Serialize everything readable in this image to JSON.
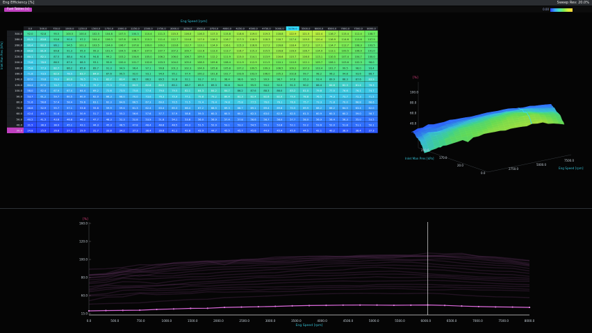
{
  "window": {
    "title": "Eng Efficiency [%]",
    "status_right": "Sweep Rev: 20.0%",
    "legend_text": "0.00"
  },
  "toolbar": {
    "chip_label": "Fuel Tables",
    "chip_suffix": "[s]"
  },
  "table": {
    "x_axis_title": "Eng Speed [rpm]",
    "y_axis_title": "Inlet Man Pres [kPa]",
    "columns": [
      "0.0",
      "500.0",
      "750.0",
      "1000.0",
      "1250.0",
      "1500.0",
      "1750.0",
      "2000.0",
      "2250.0",
      "2500.0",
      "2750.0",
      "3000.0",
      "3250.0",
      "3500.0",
      "3750.0",
      "4000.0",
      "4250.0",
      "4500.0",
      "4750.0",
      "5000.0",
      "5250.0",
      "5500.0",
      "6000.0",
      "6500.0",
      "7000.0",
      "7500.0",
      "8000.0"
    ],
    "rows": [
      "300.0",
      "280.0",
      "260.0",
      "240.0",
      "220.0",
      "200.0",
      "180.0",
      "160.0",
      "140.0",
      "120.0",
      "100.0",
      "90.0",
      "80.0",
      "70.0",
      "60.0",
      "50.0",
      "40.0",
      "30.0"
    ],
    "values": [
      [
        92.0,
        92.8,
        95.5,
        100.5,
        100.0,
        102.5,
        104.8,
        107.5,
        100.3,
        110.4,
        111.3,
        115.3,
        116.0,
        116.3,
        117.3,
        115.8,
        118.6,
        119.0,
        119.3,
        118.8,
        122.9,
        121.5,
        122.4,
        116.7,
        115.4,
        112.4,
        108.7
      ],
      [
        81.5,
        83.8,
        93.6,
        90.0,
        97.2,
        104.4,
        106.3,
        107.8,
        108.3,
        110.2,
        111.4,
        112.7,
        114.8,
        117.0,
        116.3,
        116.7,
        117.3,
        118.5,
        118.3,
        118.7,
        117.4,
        119.5,
        120.4,
        116.9,
        114.6,
        110.6,
        107.9
      ],
      [
        80.4,
        82.3,
        86.1,
        94.5,
        101.3,
        103.5,
        104.0,
        106.7,
        107.8,
        109.0,
        109.2,
        110.6,
        112.7,
        113.1,
        114.9,
        116.1,
        115.3,
        116.6,
        117.2,
        116.8,
        118.4,
        117.2,
        117.1,
        114.7,
        112.7,
        108.3,
        103.5
      ],
      [
        80.8,
        81.9,
        89.8,
        91.3,
        95.0,
        99.3,
        101.4,
        104.5,
        106.7,
        107.9,
        107.7,
        107.2,
        109.7,
        112.6,
        113.0,
        113.7,
        116.7,
        115.3,
        115.5,
        116.8,
        116.9,
        116.7,
        114.9,
        113.1,
        109.5,
        106.9,
        101.0
      ],
      [
        80.1,
        82.1,
        87.5,
        88.4,
        90.8,
        94.8,
        99.2,
        103.2,
        104.6,
        105.0,
        106.2,
        106.0,
        106.7,
        109.3,
        112.2,
        111.9,
        115.0,
        114.1,
        113.9,
        116.6,
        115.7,
        116.0,
        113.1,
        110.5,
        107.4,
        104.7,
        100.0
      ],
      [
        75.6,
        78.9,
        86.5,
        87.0,
        88.5,
        93.1,
        95.6,
        100.4,
        101.7,
        102.8,
        103.3,
        104.0,
        105.0,
        108.5,
        109.6,
        108.4,
        111.9,
        112.9,
        111.5,
        110.1,
        110.9,
        112.1,
        109.7,
        106.1,
        103.6,
        102.3,
        98.0
      ],
      [
        75.8,
        77.3,
        82.7,
        86.2,
        85.8,
        89.7,
        91.3,
        94.9,
        96.4,
        97.1,
        99.8,
        101.2,
        102.3,
        104.9,
        105.8,
        105.8,
        107.2,
        109.5,
        109.3,
        108.5,
        109.2,
        107.3,
        103.4,
        101.7,
        99.5,
        98.0,
        93.4
      ],
      [
        71.6,
        73.5,
        82.0,
        78.5,
        83.7,
        84.0,
        87.6,
        90.5,
        92.0,
        93.1,
        94.9,
        95.1,
        97.4,
        100.2,
        101.8,
        102.7,
        103.6,
        103.9,
        106.0,
        105.3,
        102.8,
        99.7,
        98.2,
        96.2,
        94.8,
        93.6,
        88.7
      ],
      [
        67.0,
        70.8,
        76.0,
        80.9,
        78.5,
        79.1,
        82.7,
        83.4,
        86.7,
        88.2,
        89.5,
        91.8,
        92.1,
        93.7,
        97.1,
        98.4,
        98.6,
        99.5,
        99.9,
        98.7,
        97.8,
        95.3,
        93.4,
        89.9,
        88.3,
        87.6,
        83.9
      ],
      [
        64.4,
        67.0,
        74.7,
        72.7,
        74.0,
        75.7,
        77.3,
        77.8,
        80.9,
        82.6,
        84.5,
        85.1,
        88.7,
        89.9,
        89.3,
        90.6,
        94.6,
        95.9,
        94.0,
        92.5,
        91.3,
        90.2,
        86.4,
        84.6,
        82.3,
        81.4,
        78.3
      ],
      [
        58.0,
        62.4,
        67.9,
        67.4,
        64.4,
        69.2,
        72.6,
        73.5,
        75.8,
        77.4,
        79.0,
        79.5,
        82.1,
        84.3,
        84.2,
        84.7,
        86.2,
        87.6,
        88.3,
        86.0,
        83.2,
        81.0,
        79.8,
        77.5,
        76.6,
        76.1,
        74.7
      ],
      [
        53.7,
        61.2,
        59.7,
        60.5,
        60.9,
        62.0,
        66.3,
        68.0,
        70.0,
        73.0,
        76.3,
        75.9,
        77.1,
        79.8,
        79.2,
        80.4,
        82.3,
        82.4,
        82.6,
        82.0,
        79.9,
        78.8,
        76.5,
        74.3,
        73.7,
        72.3,
        71.5
      ],
      [
        51.6,
        56.6,
        57.4,
        58.4,
        59.6,
        63.1,
        62.3,
        64.6,
        66.5,
        67.3,
        69.0,
        70.5,
        71.5,
        72.4,
        73.4,
        74.8,
        75.8,
        77.5,
        76.0,
        76.1,
        76.9,
        75.7,
        73.3,
        71.8,
        70.0,
        68.8,
        68.6
      ],
      [
        48.6,
        52.9,
        55.7,
        57.1,
        53.8,
        55.8,
        59.9,
        59.4,
        61.3,
        62.4,
        63.4,
        65.3,
        66.4,
        67.2,
        68.5,
        69.3,
        68.7,
        69.1,
        69.4,
        69.6,
        70.5,
        69.9,
        68.2,
        66.2,
        64.5,
        63.4,
        62.0
      ],
      [
        42.4,
        44.7,
        51.4,
        52.3,
        50.9,
        51.7,
        52.8,
        55.2,
        56.6,
        57.6,
        57.7,
        57.9,
        58.8,
        59.3,
        60.3,
        60.5,
        60.2,
        62.3,
        63.0,
        62.9,
        62.5,
        61.3,
        60.9,
        60.3,
        60.2,
        59.0,
        58.7
      ],
      [
        40.5,
        41.5,
        43.6,
        46.8,
        46.2,
        47.7,
        48.3,
        52.3,
        52.8,
        53.9,
        51.8,
        54.1,
        53.8,
        56.0,
        56.9,
        57.4,
        57.8,
        58.6,
        58.7,
        58.0,
        57.7,
        58.0,
        56.9,
        56.4,
        56.3,
        55.0,
        53.5
      ],
      [
        31.5,
        38.3,
        38.9,
        45.1,
        43.1,
        44.3,
        45.3,
        48.5,
        47.8,
        48.4,
        48.8,
        48.5,
        49.3,
        51.5,
        52.9,
        53.1,
        53.2,
        54.5,
        55.1,
        53.8,
        52.1,
        52.2,
        53.6,
        52.0,
        51.8,
        51.1,
        50.1
      ],
      [
        24.8,
        25.9,
        26.6,
        27.3,
        29.9,
        31.7,
        33.8,
        34.2,
        37.3,
        38.4,
        39.6,
        41.1,
        42.8,
        43.9,
        44.7,
        45.5,
        45.7,
        45.6,
        44.9,
        45.4,
        45.9,
        44.5,
        42.1,
        40.2,
        38.9,
        38.4,
        37.3
      ]
    ],
    "selected_column": 20
  },
  "plot3d": {
    "z_unit": "[%]",
    "z_ticks": [
      "100.0",
      "80.0",
      "60.0",
      "40.0"
    ],
    "x_axis_title": "Eng Speed [rpm]",
    "y_axis_title": "Inlet Man Pres [kPa]",
    "x_ticks": [
      "0.0",
      "2750.0",
      "5000.0",
      "7500.0"
    ],
    "y_ticks": [
      "250.0",
      "170.0",
      "20.0"
    ]
  },
  "bottom": {
    "y_unit": "[%]",
    "y_ticks": [
      "160.0",
      "120.0",
      "100.0",
      "80.0",
      "60.0",
      "15.0"
    ],
    "x_ticks": [
      "0.0",
      "500.0",
      "750.0",
      "1000.0",
      "1500.0",
      "2000.0",
      "2500.0",
      "3000.0",
      "3500.0",
      "4000.0",
      "4500.0",
      "5000.0",
      "5500.0",
      "6000.0",
      "6500.0",
      "7000.0",
      "7500.0",
      "8000.0"
    ],
    "x_axis_title": "Eng Speed [rpm]"
  },
  "colors": {
    "accent": "#35c2d6",
    "chip": "#c040c0",
    "highlight": "#33ddff"
  }
}
